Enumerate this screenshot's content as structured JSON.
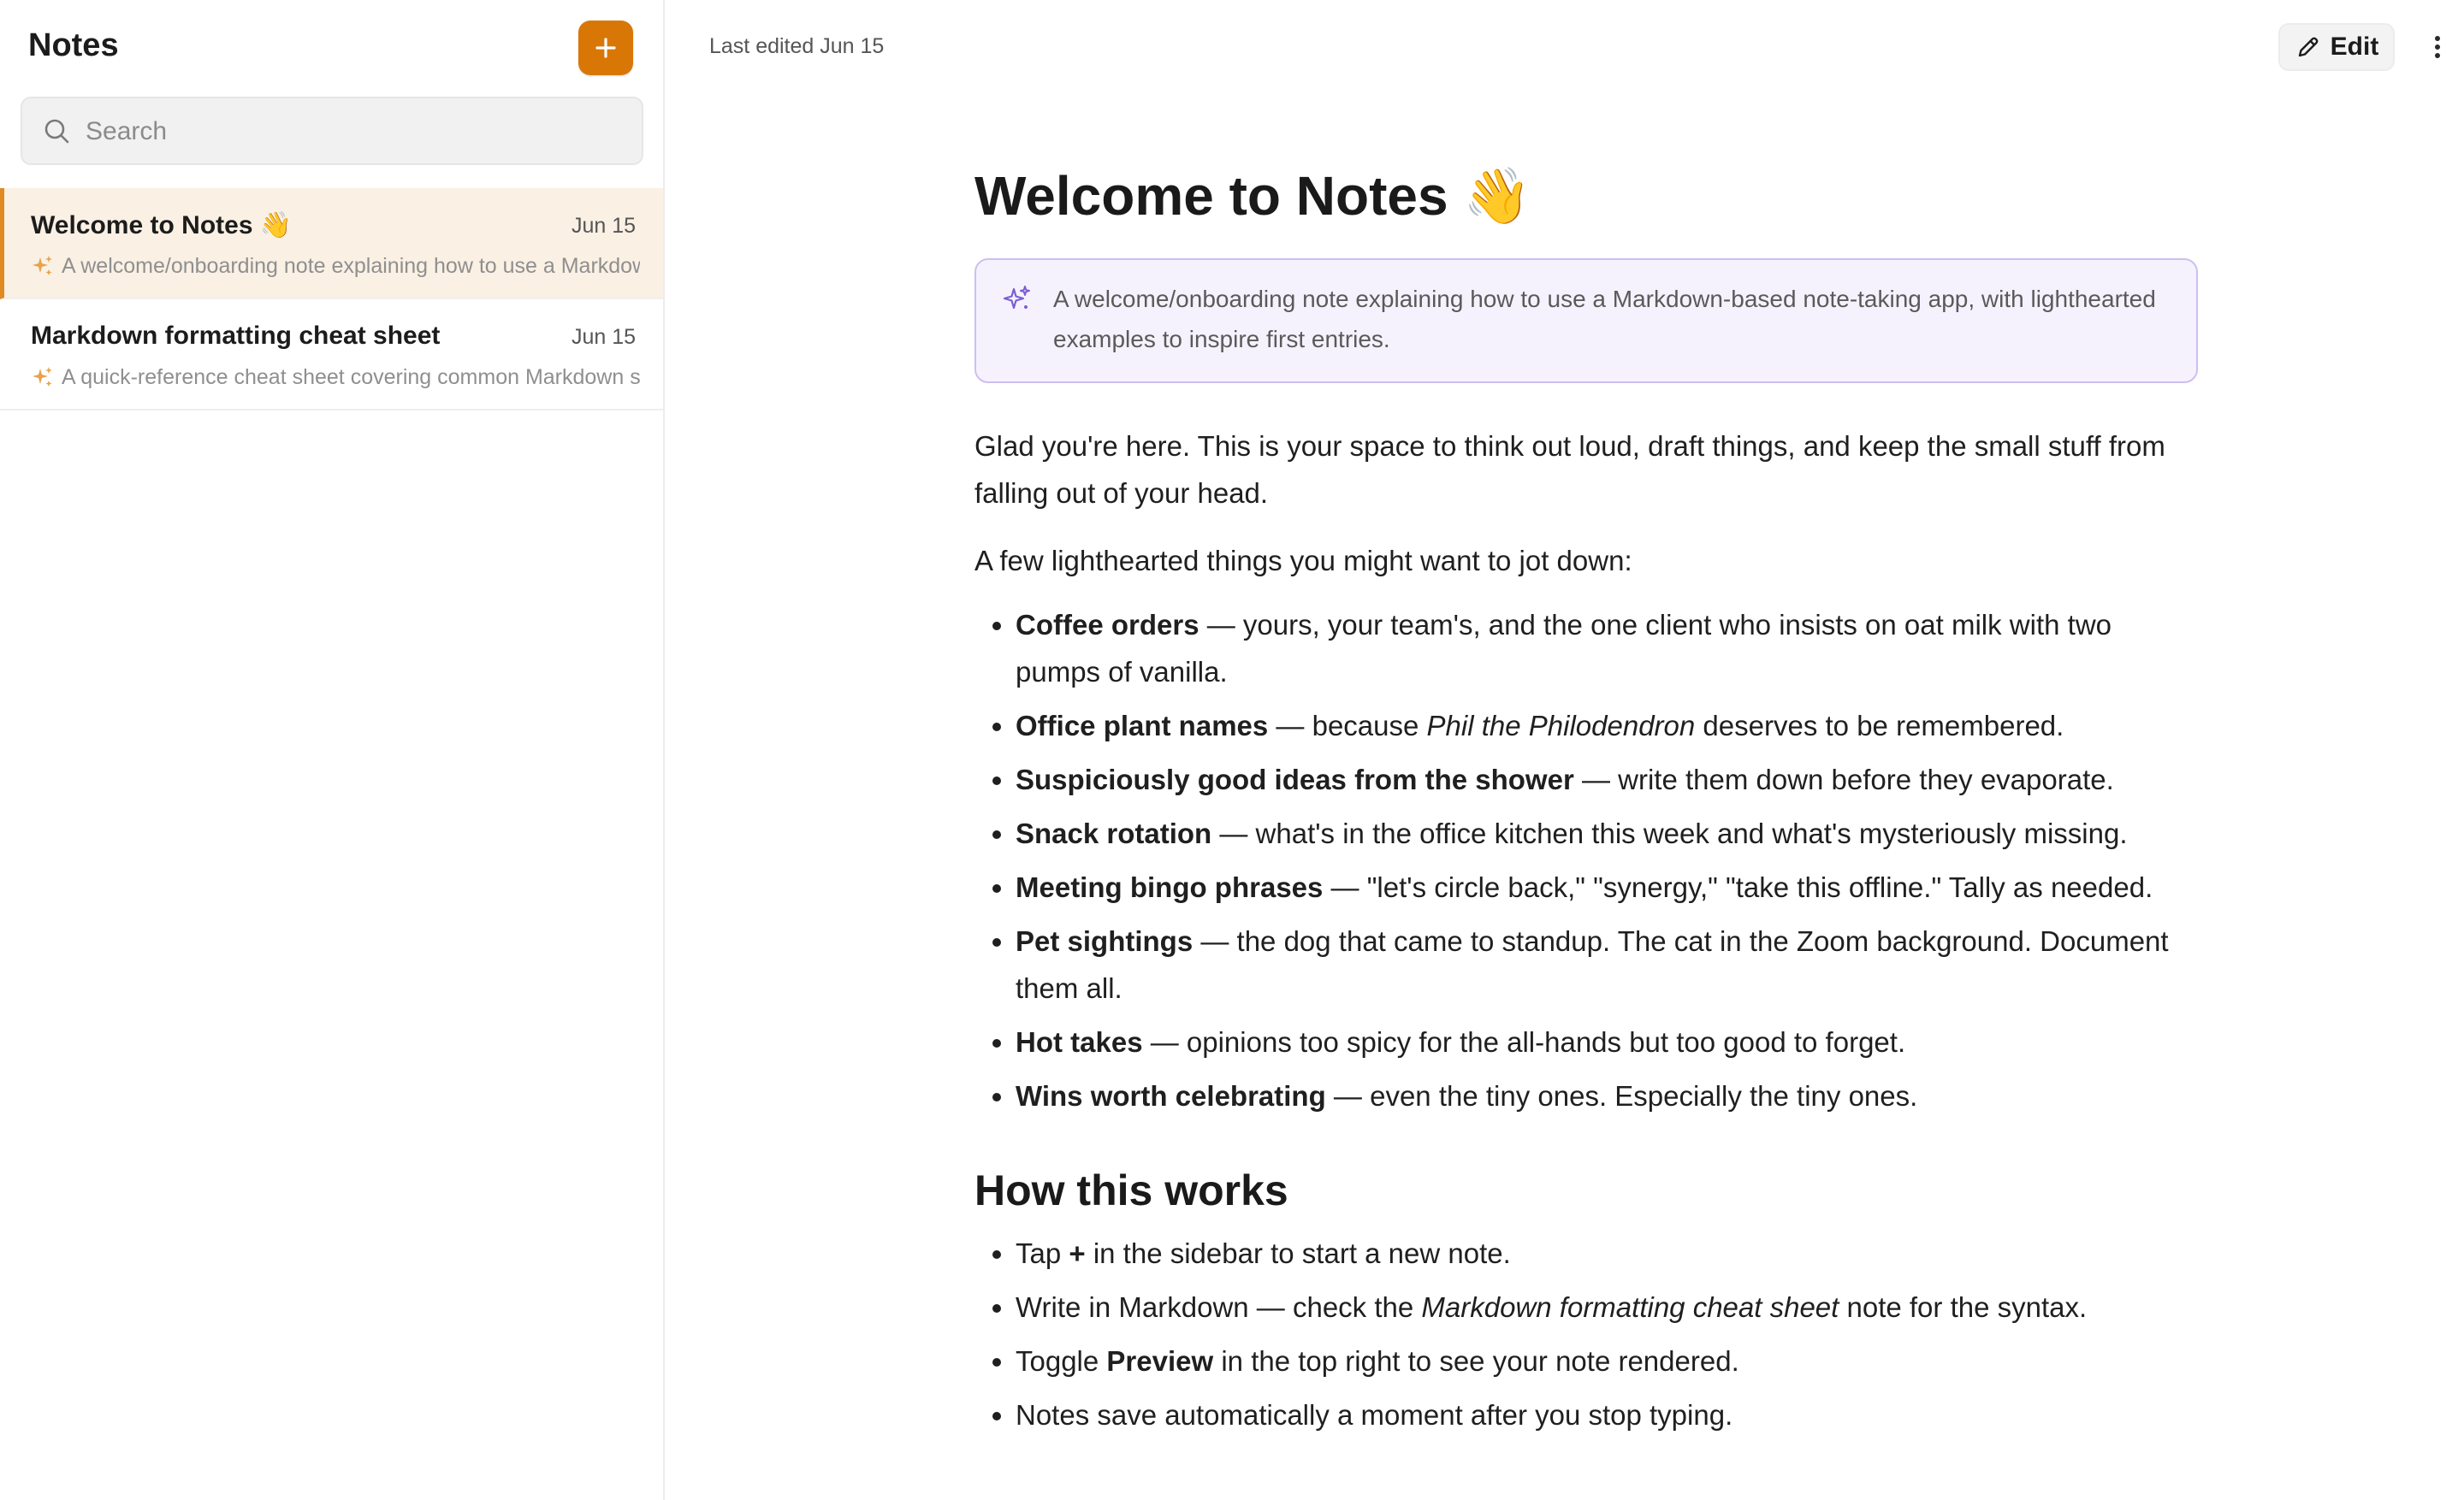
{
  "sidebar": {
    "title": "Notes",
    "new_note_label": "+",
    "search_placeholder": "Search",
    "notes": [
      {
        "title": "Welcome to Notes 👋",
        "date": "Jun 15",
        "summary": "A welcome/onboarding note explaining how to use a Markdown-based note-taking app, with lighthearted examples to inspire first entries.",
        "active": true
      },
      {
        "title": "Markdown formatting cheat sheet",
        "date": "Jun 15",
        "summary": "A quick-reference cheat sheet covering common Markdown syntax.",
        "active": false
      }
    ]
  },
  "toolbar": {
    "last_edited": "Last edited Jun 15",
    "edit_label": "Edit"
  },
  "note": {
    "title": "Welcome to Notes 👋",
    "ai_summary": "A welcome/onboarding note explaining how to use a Markdown-based note-taking app, with lighthearted examples to inspire first entries.",
    "intro": "Glad you're here. This is your space to think out loud, draft things, and keep the small stuff from falling out of your head.",
    "list_intro": "A few lighthearted things you might want to jot down:",
    "items": [
      {
        "bold": "Coffee orders",
        "rest": " — yours, your team's, and the one client who insists on oat milk with two pumps of vanilla."
      },
      {
        "bold": "Office plant names",
        "pre": " — because ",
        "italic": "Phil the Philodendron",
        "rest": " deserves to be remembered."
      },
      {
        "bold": "Suspiciously good ideas from the shower",
        "rest": " — write them down before they evaporate."
      },
      {
        "bold": "Snack rotation",
        "rest": " — what's in the office kitchen this week and what's mysteriously missing."
      },
      {
        "bold": "Meeting bingo phrases",
        "rest": " — \"let's circle back,\" \"synergy,\" \"take this offline.\" Tally as needed."
      },
      {
        "bold": "Pet sightings",
        "rest": " — the dog that came to standup. The cat in the Zoom background. Document them all."
      },
      {
        "bold": "Hot takes",
        "rest": " — opinions too spicy for the all-hands but too good to forget."
      },
      {
        "bold": "Wins worth celebrating",
        "rest": " — even the tiny ones. Especially the tiny ones."
      }
    ],
    "section_heading": "How this works",
    "how": {
      "l1_pre": "Tap ",
      "l1_bold": "+",
      "l1_post": " in the sidebar to start a new note.",
      "l2_pre": "Write in Markdown — check the ",
      "l2_italic": "Markdown formatting cheat sheet",
      "l2_post": " note for the syntax.",
      "l3_pre": "Toggle ",
      "l3_bold": "Preview",
      "l3_post": " in the top right to see your note rendered.",
      "l4": "Notes save automatically a moment after you stop typing."
    }
  },
  "colors": {
    "accent": "#d97706",
    "active_bg": "#faf0e4",
    "summary_bg": "#f5f2fd",
    "summary_border": "#cdbff0",
    "sparkle_purple": "#7c5cd6"
  }
}
